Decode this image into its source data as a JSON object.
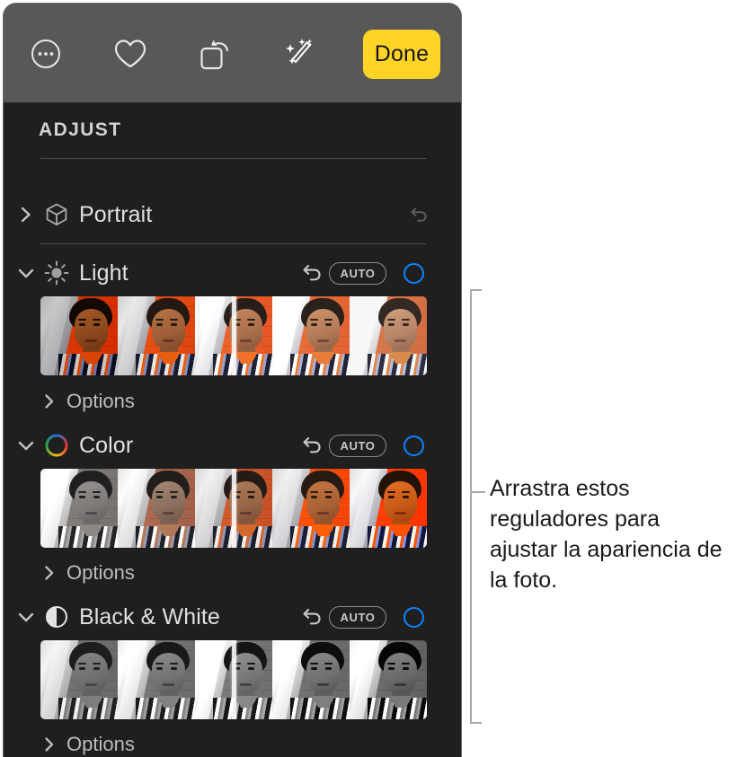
{
  "toolbar": {
    "buttons": [
      {
        "name": "more-options-icon",
        "label": "More Options"
      },
      {
        "name": "favorite-heart-icon",
        "label": "Favorite"
      },
      {
        "name": "rotate-crop-icon",
        "label": "Crop & Rotate"
      },
      {
        "name": "magic-wand-icon",
        "label": "Enhance"
      }
    ],
    "done_label": "Done",
    "done_color": "#FFD426",
    "background_color": "#585858"
  },
  "panel": {
    "heading": "ADJUST",
    "background_color": "#1f1f1f",
    "accent_color": "#0A84FF"
  },
  "groups": [
    {
      "id": "portrait",
      "title": "Portrait",
      "icon": "cube-icon",
      "expanded": false,
      "disclosure": "chevron-right-icon",
      "has_reset": true,
      "reset_enabled": false,
      "has_auto": false,
      "has_toggle": false,
      "has_filmstrip": false,
      "options_label": null
    },
    {
      "id": "light",
      "title": "Light",
      "icon": "sun-icon",
      "expanded": true,
      "disclosure": "chevron-down-icon",
      "has_reset": true,
      "reset_enabled": true,
      "has_auto": true,
      "auto_label": "AUTO",
      "has_toggle": true,
      "has_filmstrip": true,
      "filmstrip_frames": 5,
      "playhead_percent": 50,
      "options_label": "Options"
    },
    {
      "id": "color",
      "title": "Color",
      "icon": "color-wheel-icon",
      "expanded": true,
      "disclosure": "chevron-down-icon",
      "has_reset": true,
      "reset_enabled": true,
      "has_auto": true,
      "auto_label": "AUTO",
      "has_toggle": true,
      "has_filmstrip": true,
      "filmstrip_frames": 5,
      "playhead_percent": 50,
      "options_label": "Options"
    },
    {
      "id": "black-and-white",
      "title": "Black & White",
      "icon": "contrast-circle-icon",
      "expanded": true,
      "disclosure": "chevron-down-icon",
      "has_reset": true,
      "reset_enabled": true,
      "has_auto": true,
      "auto_label": "AUTO",
      "has_toggle": true,
      "has_filmstrip": true,
      "filmstrip_frames": 5,
      "playhead_percent": 50,
      "options_label": "Options"
    }
  ],
  "callout": {
    "text": "Arrastra estos reguladores para ajustar la apariencia de la foto.",
    "bracket_color": "#a8a8a8",
    "text_color": "#1a1a1a"
  }
}
